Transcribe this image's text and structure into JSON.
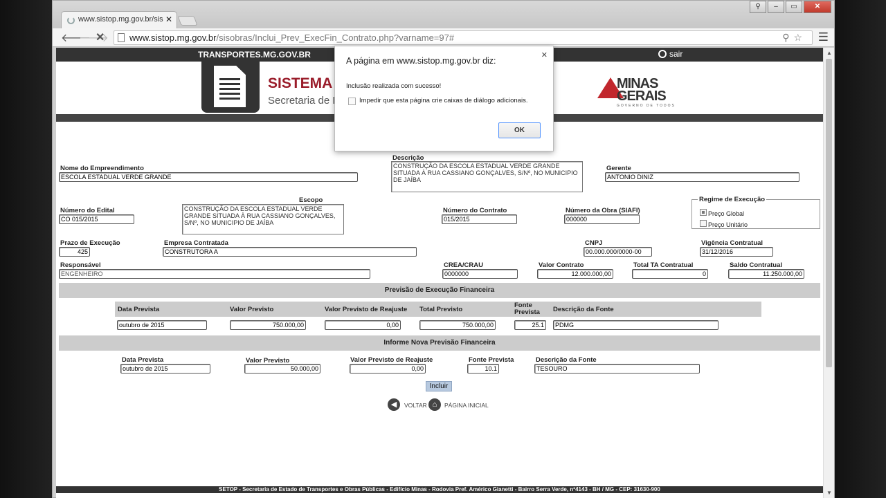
{
  "browser": {
    "tab_title": "www.sistop.mg.gov.br/sis",
    "url_host": "www.sistop.mg.gov.br",
    "url_path": "/sisobras/Inclui_Prev_ExecFin_Contrato.php?varname=97#"
  },
  "site": {
    "top_label": "TRANSPORTES.MG.GOV.BR",
    "logout": "sair",
    "system_title": "SISTEMA C",
    "system_subtitle": "Secretaria de E",
    "logo_line1": "MINAS",
    "logo_line2": "GERAIS",
    "logo_line3": "GOVERNO DE TODOS"
  },
  "form": {
    "nome_empreendimento_label": "Nome do Empreendimento",
    "nome_empreendimento": "ESCOLA ESTADUAL VERDE GRANDE",
    "descricao_label": "Descrição",
    "descricao": "CONSTRUÇÃO DA ESCOLA ESTADUAL VERDE GRANDE SITUADA À RUA CASSIANO GONÇALVES, S/Nº, NO MUNICIPIO DE JAÍBA",
    "gerente_label": "Gerente",
    "gerente": "ANTONIO DINIZ",
    "escopo_label": "Escopo",
    "escopo": "CONSTRUÇÃO DA ESCOLA ESTADUAL VERDE GRANDE SITUADA À RUA CASSIANO GONÇALVES, S/Nº, NO MUNICIPIO DE JAÍBA",
    "numero_edital_label": "Número do Edital",
    "numero_edital": "CO 015/2015",
    "numero_contrato_label": "Número do Contrato",
    "numero_contrato": "015/2015",
    "numero_obra_label": "Número da Obra (SIAFI)",
    "numero_obra": "000000",
    "regime_label": "Regime de Execução",
    "regime_global": "Preço Global",
    "regime_unitario": "Preço Unitário",
    "prazo_label": "Prazo de Execução",
    "prazo": "425",
    "empresa_label": "Empresa Contratada",
    "empresa": "CONSTRUTORA A",
    "cnpj_label": "CNPJ",
    "cnpj": "00.000.000/0000-00",
    "vigencia_label": "Vigência Contratual",
    "vigencia": "31/12/2016",
    "responsavel_label": "Responsável",
    "responsavel": "ENGENHEIRO",
    "crea_label": "CREA/CRAU",
    "crea": "0000000",
    "valor_contrato_label": "Valor Contrato",
    "valor_contrato": "12.000.000,00",
    "total_ta_label": "Total TA Contratual",
    "total_ta": "0",
    "saldo_label": "Saldo Contratual",
    "saldo": "11.250.000,00"
  },
  "previsao": {
    "section_title": "Previsão de Execução Financeira",
    "headers": [
      "Data Prevista",
      "Valor Previsto",
      "Valor Previsto de Reajuste",
      "Total Previsto",
      "Fonte Prevista",
      "Descrição da Fonte"
    ],
    "row": [
      "outubro de 2015",
      "750.000,00",
      "0,00",
      "750.000,00",
      "25.1",
      "PDMG"
    ]
  },
  "nova": {
    "section_title": "Informe Nova Previsão Financeira",
    "headers": [
      "Data Prevista",
      "Valor Previsto",
      "Valor Previsto de Reajuste",
      "Fonte Prevista",
      "Descrição da Fonte"
    ],
    "row": [
      "outubro de 2015",
      "50.000,00",
      "0,00",
      "10.1",
      "TESOURO"
    ],
    "submit": "Incluir"
  },
  "nav": {
    "voltar": "VOLTAR",
    "inicial": "PÁGINA INICIAL"
  },
  "footer": "SETOP - Secretaria de Estado de Transportes e Obras Públicas - Edifício Minas - Rodovia Pref. Américo Gianetti - Bairro Serra Verde, nº4143 - BH / MG - CEP: 31630-900",
  "dialog": {
    "title": "A página em www.sistop.mg.gov.br diz:",
    "message": "Inclusão realizada com sucesso!",
    "checkbox": "Impedir que esta página crie caixas de diálogo adicionais.",
    "ok": "OK"
  }
}
